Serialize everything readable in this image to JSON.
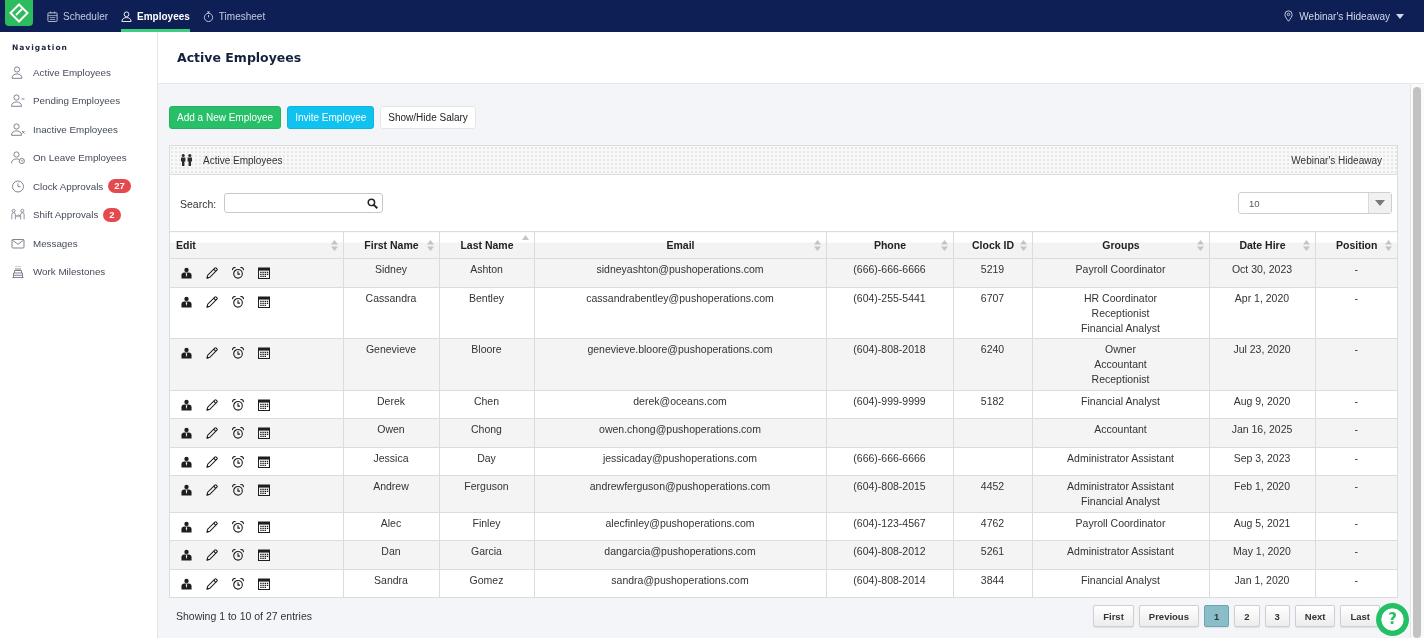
{
  "top_nav": {
    "tabs": [
      {
        "label": "Scheduler",
        "selected": false
      },
      {
        "label": "Employees",
        "selected": true
      },
      {
        "label": "Timesheet",
        "selected": false
      }
    ],
    "location": {
      "label": "Webinar's Hideaway"
    }
  },
  "sidebar": {
    "heading": "Navigation",
    "items": [
      {
        "label": "Active Employees"
      },
      {
        "label": "Pending Employees"
      },
      {
        "label": "Inactive Employees"
      },
      {
        "label": "On Leave Employees"
      },
      {
        "label": "Clock Approvals",
        "badge": "27"
      },
      {
        "label": "Shift Approvals",
        "badge": "2"
      },
      {
        "label": "Messages"
      },
      {
        "label": "Work Milestones"
      }
    ]
  },
  "page": {
    "title": "Active Employees"
  },
  "actions": [
    {
      "label": "Add a New Employee",
      "kind": "success"
    },
    {
      "label": "Invite Employee",
      "kind": "info"
    },
    {
      "label": "Show/Hide Salary",
      "kind": "default"
    }
  ],
  "panel": {
    "title": "Active Employees",
    "location": "Webinar's Hideaway",
    "search": {
      "label": "Search:"
    },
    "page_length": {
      "value": "10"
    }
  },
  "table": {
    "columns": [
      {
        "label": "Edit",
        "sorted": false
      },
      {
        "label": "First Name",
        "sorted": false
      },
      {
        "label": "Last Name",
        "sorted": true
      },
      {
        "label": "Email",
        "sorted": false
      },
      {
        "label": "Phone",
        "sorted": false
      },
      {
        "label": "Clock ID",
        "sorted": false
      },
      {
        "label": "Groups",
        "sorted": false
      },
      {
        "label": "Date Hire",
        "sorted": false
      },
      {
        "label": "Position",
        "sorted": false
      }
    ],
    "rows": [
      {
        "first_name": "Sidney",
        "last_name": "Ashton",
        "email": "sidneyashton@pushoperations.com",
        "phone": "(666)-666-6666",
        "clock_id": "5219",
        "groups": [
          "Payroll Coordinator"
        ],
        "date_hire": "Oct 30, 2023",
        "position": "-"
      },
      {
        "first_name": "Cassandra",
        "last_name": "Bentley",
        "email": "cassandrabentley@pushoperations.com",
        "phone": "(604)-255-5441",
        "clock_id": "6707",
        "groups": [
          "HR Coordinator",
          "Receptionist",
          "Financial Analyst"
        ],
        "date_hire": "Apr 1, 2020",
        "position": "-"
      },
      {
        "first_name": "Genevieve",
        "last_name": "Bloore",
        "email": "genevieve.bloore@pushoperations.com",
        "phone": "(604)-808-2018",
        "clock_id": "6240",
        "groups": [
          "Owner",
          "Accountant",
          "Receptionist"
        ],
        "date_hire": "Jul 23, 2020",
        "position": "-"
      },
      {
        "first_name": "Derek",
        "last_name": "Chen",
        "email": "derek@oceans.com",
        "phone": "(604)-999-9999",
        "clock_id": "5182",
        "groups": [
          "Financial Analyst"
        ],
        "date_hire": "Aug 9, 2020",
        "position": "-"
      },
      {
        "first_name": "Owen",
        "last_name": "Chong",
        "email": "owen.chong@pushoperations.com",
        "groups": [
          "Accountant"
        ],
        "date_hire": "Jan 16, 2025",
        "position": "-"
      },
      {
        "first_name": "Jessica",
        "last_name": "Day",
        "email": "jessicaday@pushoperations.com",
        "phone": "(666)-666-6666",
        "groups": [
          "Administrator Assistant"
        ],
        "date_hire": "Sep 3, 2023",
        "position": "-"
      },
      {
        "first_name": "Andrew",
        "last_name": "Ferguson",
        "email": "andrewferguson@pushoperations.com",
        "phone": "(604)-808-2015",
        "clock_id": "4452",
        "groups": [
          "Administrator Assistant",
          "Financial Analyst"
        ],
        "date_hire": "Feb 1, 2020",
        "position": "-"
      },
      {
        "first_name": "Alec",
        "last_name": "Finley",
        "email": "alecfinley@pushoperations.com",
        "phone": "(604)-123-4567",
        "clock_id": "4762",
        "groups": [
          "Payroll Coordinator"
        ],
        "date_hire": "Aug 5, 2021",
        "position": "-"
      },
      {
        "first_name": "Dan",
        "last_name": "Garcia",
        "email": "dangarcia@pushoperations.com",
        "phone": "(604)-808-2012",
        "clock_id": "5261",
        "groups": [
          "Administrator Assistant"
        ],
        "date_hire": "May 1, 2020",
        "position": "-"
      },
      {
        "first_name": "Sandra",
        "last_name": "Gomez",
        "email": "sandra@pushoperations.com",
        "phone": "(604)-808-2014",
        "clock_id": "3844",
        "groups": [
          "Financial Analyst"
        ],
        "date_hire": "Jan 1, 2020",
        "position": "-"
      }
    ]
  },
  "footer": {
    "info": "Showing 1 to 10 of 27 entries",
    "pagination": [
      {
        "label": "First",
        "selected": false
      },
      {
        "label": "Previous",
        "selected": false
      },
      {
        "label": "1",
        "selected": true
      },
      {
        "label": "2",
        "selected": false
      },
      {
        "label": "3",
        "selected": false
      },
      {
        "label": "Next",
        "selected": false
      },
      {
        "label": "Last",
        "selected": false
      }
    ]
  },
  "help_button": {
    "label": "?"
  }
}
